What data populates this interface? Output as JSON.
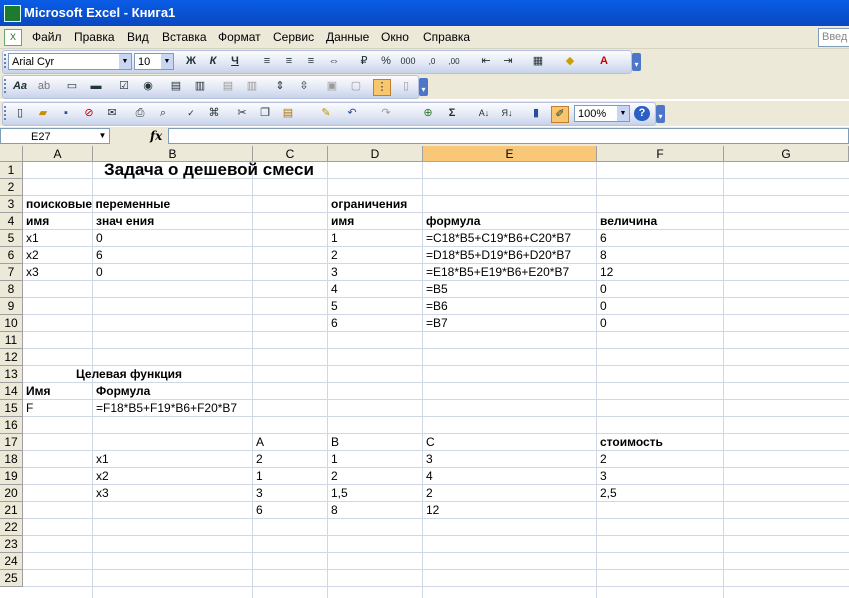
{
  "window": {
    "title": "Microsoft Excel - Книга1"
  },
  "menu": {
    "items": [
      "Файл",
      "Правка",
      "Вид",
      "Вставка",
      "Формат",
      "Сервис",
      "Данные",
      "Окно",
      "Справка"
    ],
    "ask_placeholder": "Введ"
  },
  "toolbar_format": {
    "font": "Arial Cyr",
    "size": "10",
    "bold": "Ж",
    "italic": "К",
    "underline": "Ч",
    "percent": "%",
    "thousands": "000"
  },
  "toolbar_standard": {
    "zoom": "100%",
    "sum": "Σ"
  },
  "formula_bar": {
    "name_box": "E27",
    "fx": "fx",
    "formula": ""
  },
  "columns": [
    "A",
    "B",
    "C",
    "D",
    "E",
    "F",
    "G"
  ],
  "selected_column": "E",
  "rows": [
    "1",
    "2",
    "3",
    "4",
    "5",
    "6",
    "7",
    "8",
    "9",
    "10",
    "11",
    "12",
    "13",
    "14",
    "15",
    "16",
    "17",
    "18",
    "19",
    "20",
    "21",
    "22",
    "23",
    "24",
    "25"
  ],
  "cells": {
    "B1": "Задача о дешевой смеси",
    "A3": "поисковые переменные",
    "D3": "ограничения",
    "A4": "имя",
    "B4": "знач ения",
    "D4": "имя",
    "E4": "формула",
    "F4": "величина",
    "A5": "x1",
    "B5": "0",
    "D5": "1",
    "E5": "=C18*B5+C19*B6+C20*B7",
    "F5": "6",
    "A6": "x2",
    "B6": "6",
    "D6": "2",
    "E6": "=D18*B5+D19*B6+D20*B7",
    "F6": "8",
    "A7": "x3",
    "B7": "0",
    "D7": "3",
    "E7": "=E18*B5+E19*B6+E20*B7",
    "F7": "12",
    "D8": "4",
    "E8": "=B5",
    "F8": "0",
    "D9": "5",
    "E9": "=B6",
    "F9": "0",
    "D10": "6",
    "E10": "=B7",
    "F10": "0",
    "A13": "Целевая функция",
    "A14": "Имя",
    "B14": "Формула",
    "A15": "F",
    "B15": "=F18*B5+F19*B6+F20*B7",
    "C17": "A",
    "D17": "B",
    "E17": "C",
    "F17": "стоимость",
    "B18": "x1",
    "C18": "2",
    "D18": "1",
    "E18": "3",
    "F18": "2",
    "B19": "x2",
    "C19": "1",
    "D19": "2",
    "E19": "4",
    "F19": "3",
    "B20": "x3",
    "C20": "3",
    "D20": "1,5",
    "E20": "2",
    "F20": "2,5",
    "C21": "6",
    "D21": "8",
    "E21": "12"
  }
}
